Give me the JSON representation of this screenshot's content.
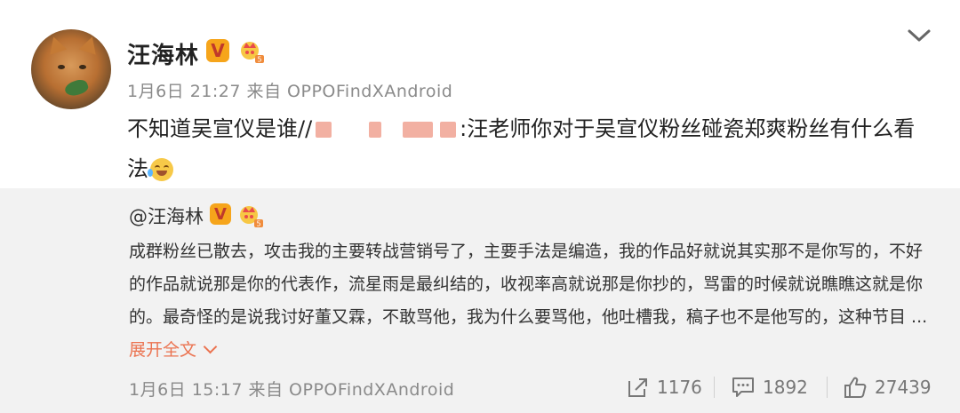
{
  "user": {
    "name": "汪海林",
    "verified_badge": "V",
    "member_icon": "crown-icon"
  },
  "post": {
    "time_source": "1月6日 21:27 来自 OPPOFindXAndroid",
    "text_before": "不知道吴宣仪是谁//",
    "text_after": ":汪老师你对于吴宣仪粉丝碰瓷郑爽粉丝有什么看法",
    "emoji": "laugh-cry-emoji"
  },
  "quoted": {
    "author": "@汪海林",
    "text": "成群粉丝已散去，攻击我的主要转战营销号了，主要手法是编造，我的作品好就说其实那不是你写的，不好的作品就说那是你的代表作，流星雨是最纠结的，收视率高就说那是你抄的，骂雷的时候就说瞧瞧这就是你的。最奇怪的是说我讨好董又霖，不敢骂他，我为什么要骂他，他吐槽我，稿子也不是他写的，这种节目 ...",
    "expand_label": "展开全文",
    "time_source": "1月6日 15:17 来自 OPPOFindXAndroid",
    "reposts": "1176",
    "comments": "1892",
    "likes": "27439"
  },
  "colors": {
    "accent": "#eb7350",
    "quote_bg": "#f2f2f2",
    "meta_gray": "#8a8a8a",
    "vip_gold": "#f6a51b"
  }
}
